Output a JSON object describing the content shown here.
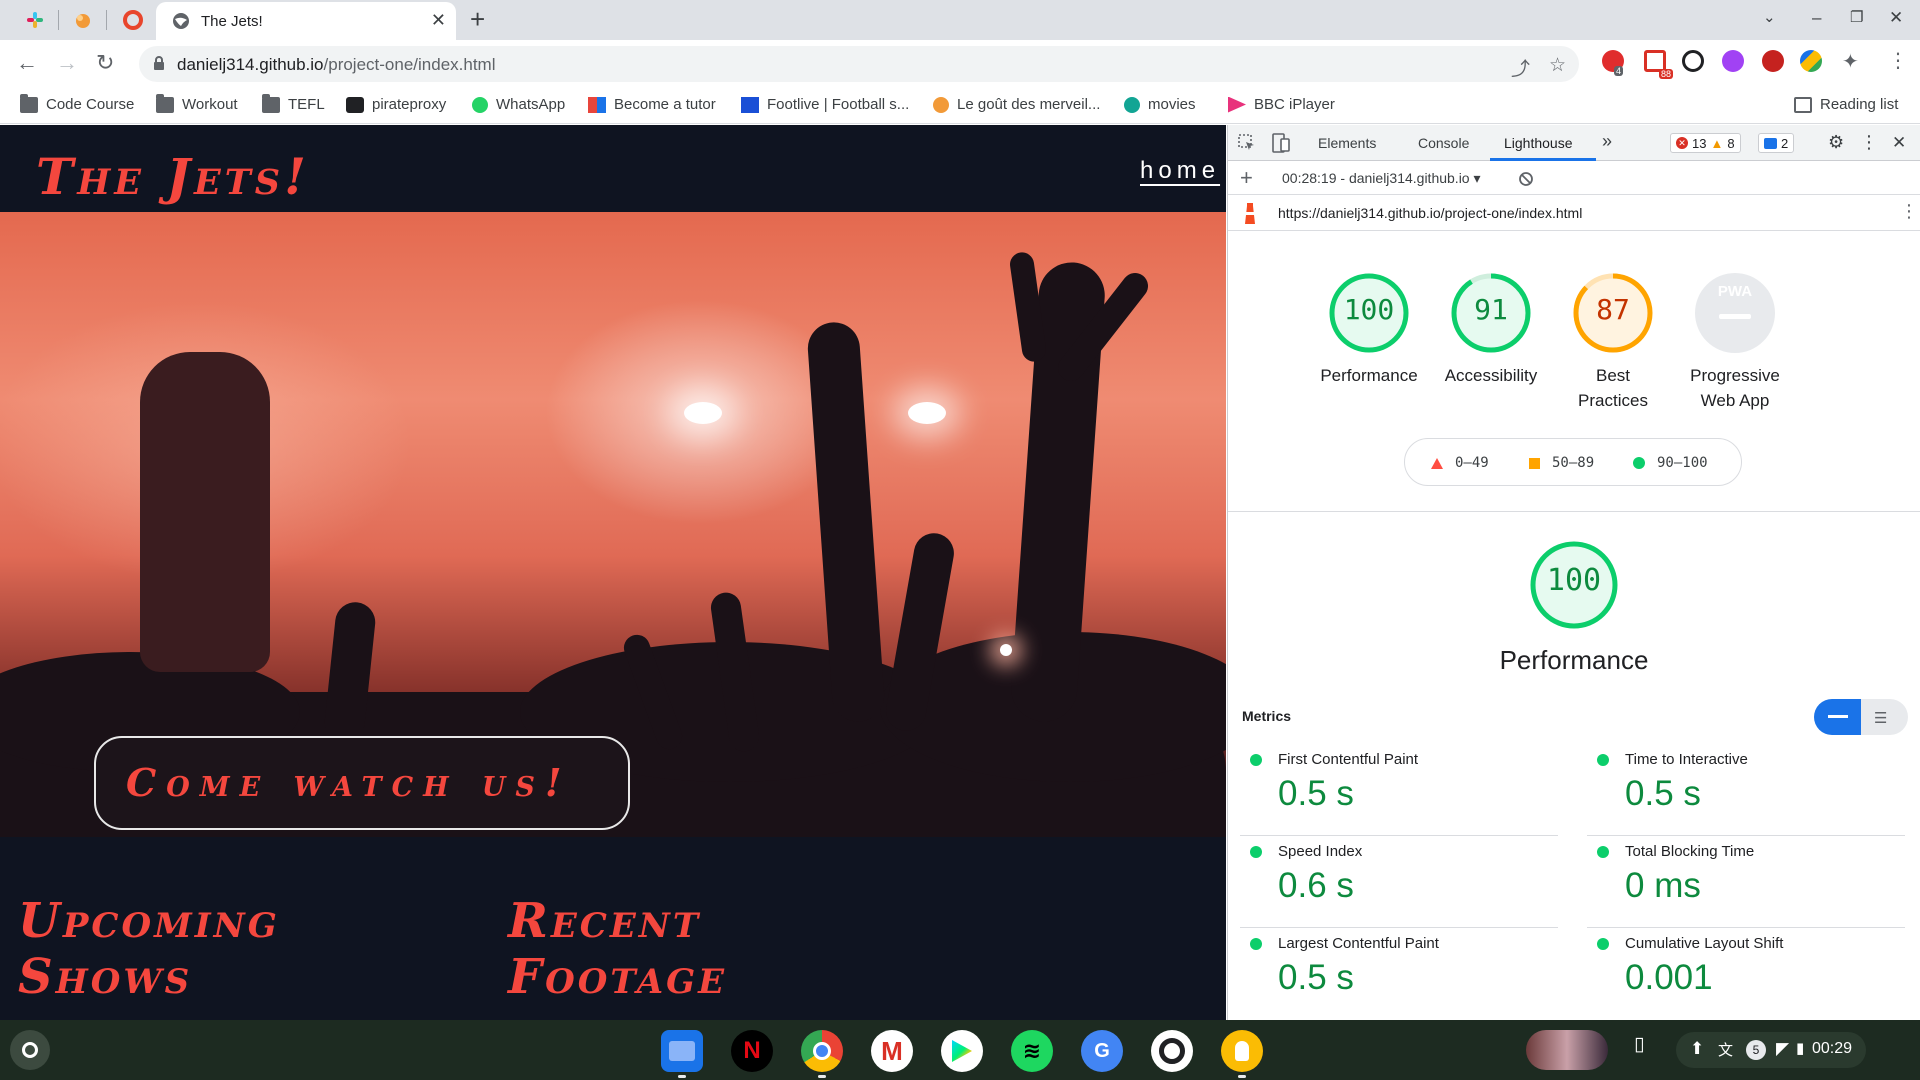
{
  "browser": {
    "active_tab_title": "The Jets!",
    "url_host": "danielj314.github.io",
    "url_path": "/project-one/index.html",
    "new_tab_icon": "plus-icon",
    "extension_badges": {
      "first": "4",
      "gmail": "88"
    },
    "bookmarks": [
      {
        "label": "Code Course",
        "icon": "folder-icon"
      },
      {
        "label": "Workout",
        "icon": "folder-icon"
      },
      {
        "label": "TEFL",
        "icon": "folder-icon"
      },
      {
        "label": "pirateproxy",
        "icon": "pirate-icon"
      },
      {
        "label": "WhatsApp",
        "icon": "whatsapp-icon"
      },
      {
        "label": "Become a tutor",
        "icon": "tutor-icon"
      },
      {
        "label": "Footlive | Football s...",
        "icon": "footlive-icon"
      },
      {
        "label": "Le goût des merveil...",
        "icon": "play-icon"
      },
      {
        "label": "movies",
        "icon": "movies-icon"
      },
      {
        "label": "BBC iPlayer",
        "icon": "iplayer-icon"
      }
    ],
    "reading_list_label": "Reading list"
  },
  "site": {
    "logo": "The Jets!",
    "nav_home": "home",
    "hero_cta": "Come watch us!",
    "section_upcoming": "Upcoming Shows",
    "section_recent": "Recent Footage"
  },
  "devtools": {
    "tabs": [
      "Elements",
      "Console",
      "Lighthouse"
    ],
    "active_tab": "Lighthouse",
    "errors_count": "13",
    "warnings_count": "8",
    "messages_count": "2",
    "report_selector": "00:28:19 - danielj314.github.io",
    "report_url": "https://danielj314.github.io/project-one/index.html",
    "categories": [
      {
        "score": "100",
        "label_line1": "Performance",
        "label_line2": "",
        "fraction": 1.0,
        "color": "#0cce6b"
      },
      {
        "score": "91",
        "label_line1": "Accessibility",
        "label_line2": "",
        "fraction": 0.91,
        "color": "#0cce6b"
      },
      {
        "score": "87",
        "label_line1": "Best",
        "label_line2": "Practices",
        "fraction": 0.87,
        "color": "#ffa400"
      },
      {
        "score": "",
        "label_line1": "Progressive",
        "label_line2": "Web App",
        "badge": "PWA",
        "fraction": 0,
        "color": "#9aa0a6"
      }
    ],
    "legend": [
      {
        "range": "0–49",
        "color": "#ff4e42",
        "shape": "triangle"
      },
      {
        "range": "50–89",
        "color": "#ffa400",
        "shape": "square"
      },
      {
        "range": "90–100",
        "color": "#0cce6b",
        "shape": "circle"
      }
    ],
    "performance_big_score": "100",
    "performance_title": "Performance",
    "metrics_heading": "Metrics",
    "metrics": [
      {
        "name": "First Contentful Paint",
        "value": "0.5 s"
      },
      {
        "name": "Time to Interactive",
        "value": "0.5 s"
      },
      {
        "name": "Speed Index",
        "value": "0.6 s"
      },
      {
        "name": "Total Blocking Time",
        "value": "0 ms"
      },
      {
        "name": "Largest Contentful Paint",
        "value": "0.5 s"
      },
      {
        "name": "Cumulative Layout Shift",
        "value": "0.001"
      }
    ]
  },
  "shelf": {
    "apps": [
      "files-icon",
      "netflix-icon",
      "chrome-icon",
      "gmail-icon",
      "play-store-icon",
      "spotify-icon",
      "translate-icon",
      "camera-icon",
      "keep-icon"
    ],
    "notification_count": "5",
    "clock": "00:29"
  }
}
